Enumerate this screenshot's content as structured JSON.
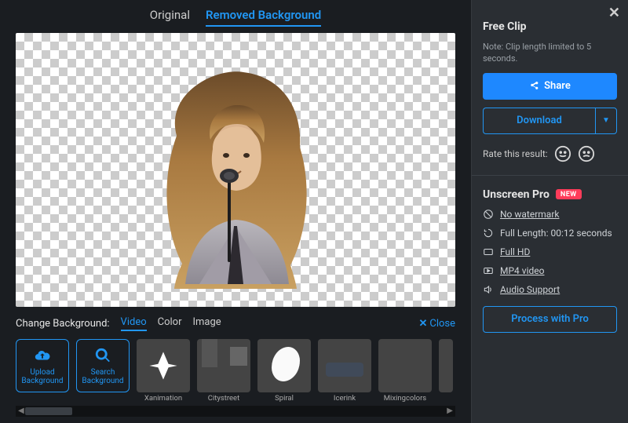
{
  "tabs": {
    "original": "Original",
    "removed_bg": "Removed Background"
  },
  "bg_bar": {
    "label": "Change Background:",
    "video": "Video",
    "color": "Color",
    "image": "Image",
    "close": "Close"
  },
  "actions": {
    "upload_bg": "Upload Background",
    "search_bg": "Search Background"
  },
  "thumbs": [
    {
      "label": "Xanimation"
    },
    {
      "label": "Citystreet"
    },
    {
      "label": "Spiral"
    },
    {
      "label": "Icerink"
    },
    {
      "label": "Mixingcolors"
    }
  ],
  "sidebar": {
    "free_title": "Free Clip",
    "free_note": "Note: Clip length limited to 5 seconds.",
    "share": "Share",
    "download": "Download",
    "rate_label": "Rate this result:",
    "pro_title": "Unscreen Pro",
    "new_badge": "NEW",
    "features": {
      "nowatermark": "No watermark",
      "fulllength": "Full Length: 00:12 seconds",
      "fullhd": "Full HD",
      "mp4": "MP4 video",
      "audio": "Audio Support"
    },
    "process_pro": "Process with Pro"
  }
}
